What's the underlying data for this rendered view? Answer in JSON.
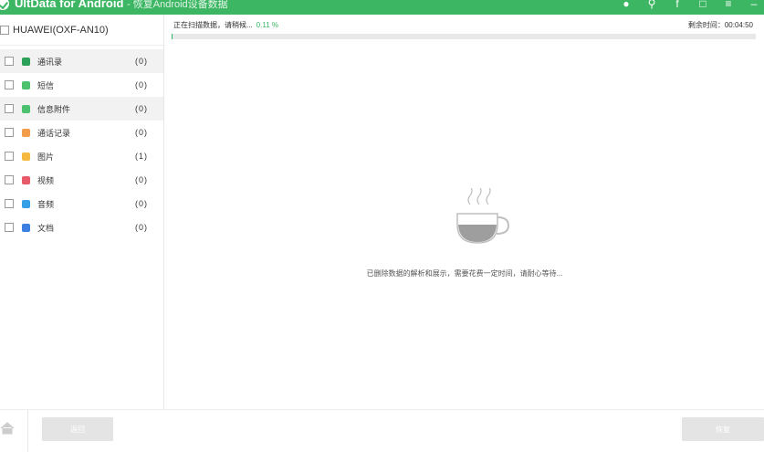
{
  "app": {
    "title": "UltData for Android",
    "subtitle": "- 恢复Android设备数据",
    "colors": {
      "brand": "#3cb663",
      "progress_track": "#e8e8e8",
      "button_disabled": "#e4e4e4"
    }
  },
  "titlebar_icons": [
    "bulb-icon",
    "key-icon",
    "facebook-icon",
    "chat-icon",
    "menu-icon",
    "minimize-icon"
  ],
  "device": {
    "name": "HUAWEI(OXF-AN10)"
  },
  "categories": [
    {
      "label": "通讯录",
      "count": "(0)",
      "icon": "contacts-icon",
      "color": "#2da05a",
      "highlight": true
    },
    {
      "label": "短信",
      "count": "(0)",
      "icon": "sms-icon",
      "color": "#4cc26e",
      "highlight": false
    },
    {
      "label": "信息附件",
      "count": "(0)",
      "icon": "attachment-icon",
      "color": "#4cc26e",
      "highlight": true
    },
    {
      "label": "通话记录",
      "count": "(0)",
      "icon": "call-log-icon",
      "color": "#f39c4a",
      "highlight": false
    },
    {
      "label": "图片",
      "count": "(1)",
      "icon": "photo-icon",
      "color": "#f5b940",
      "highlight": false
    },
    {
      "label": "视频",
      "count": "(0)",
      "icon": "video-icon",
      "color": "#e85a6a",
      "highlight": false
    },
    {
      "label": "音频",
      "count": "(0)",
      "icon": "audio-icon",
      "color": "#35a0e6",
      "highlight": false
    },
    {
      "label": "文档",
      "count": "(0)",
      "icon": "document-icon",
      "color": "#3b7fe0",
      "highlight": false
    }
  ],
  "scan": {
    "status_text": "正在扫描数据，请稍候...",
    "percent_text": "0.11 %",
    "progress": 0.0011,
    "time_left_label": "剩余时间：",
    "time_left_value": "00:04:50"
  },
  "empty_state": {
    "message": "已删除数据的解析和展示，需要花费一定时间，请耐心等待..."
  },
  "footer": {
    "back_label": "返回",
    "recover_label": "恢复"
  }
}
